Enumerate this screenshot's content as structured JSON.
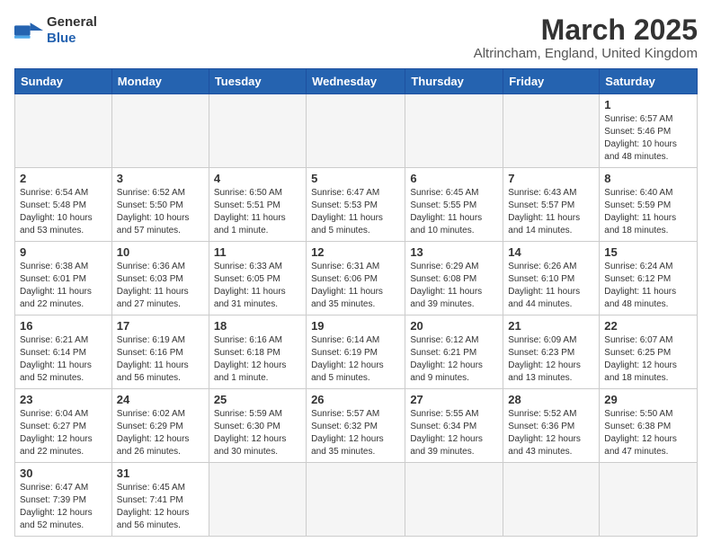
{
  "logo": {
    "line1": "General",
    "line2": "Blue"
  },
  "title": {
    "month_year": "March 2025",
    "location": "Altrincham, England, United Kingdom"
  },
  "headers": [
    "Sunday",
    "Monday",
    "Tuesday",
    "Wednesday",
    "Thursday",
    "Friday",
    "Saturday"
  ],
  "weeks": [
    [
      {
        "day": "",
        "info": ""
      },
      {
        "day": "",
        "info": ""
      },
      {
        "day": "",
        "info": ""
      },
      {
        "day": "",
        "info": ""
      },
      {
        "day": "",
        "info": ""
      },
      {
        "day": "",
        "info": ""
      },
      {
        "day": "1",
        "info": "Sunrise: 6:57 AM\nSunset: 5:46 PM\nDaylight: 10 hours and 48 minutes."
      }
    ],
    [
      {
        "day": "2",
        "info": "Sunrise: 6:54 AM\nSunset: 5:48 PM\nDaylight: 10 hours and 53 minutes."
      },
      {
        "day": "3",
        "info": "Sunrise: 6:52 AM\nSunset: 5:50 PM\nDaylight: 10 hours and 57 minutes."
      },
      {
        "day": "4",
        "info": "Sunrise: 6:50 AM\nSunset: 5:51 PM\nDaylight: 11 hours and 1 minute."
      },
      {
        "day": "5",
        "info": "Sunrise: 6:47 AM\nSunset: 5:53 PM\nDaylight: 11 hours and 5 minutes."
      },
      {
        "day": "6",
        "info": "Sunrise: 6:45 AM\nSunset: 5:55 PM\nDaylight: 11 hours and 10 minutes."
      },
      {
        "day": "7",
        "info": "Sunrise: 6:43 AM\nSunset: 5:57 PM\nDaylight: 11 hours and 14 minutes."
      },
      {
        "day": "8",
        "info": "Sunrise: 6:40 AM\nSunset: 5:59 PM\nDaylight: 11 hours and 18 minutes."
      }
    ],
    [
      {
        "day": "9",
        "info": "Sunrise: 6:38 AM\nSunset: 6:01 PM\nDaylight: 11 hours and 22 minutes."
      },
      {
        "day": "10",
        "info": "Sunrise: 6:36 AM\nSunset: 6:03 PM\nDaylight: 11 hours and 27 minutes."
      },
      {
        "day": "11",
        "info": "Sunrise: 6:33 AM\nSunset: 6:05 PM\nDaylight: 11 hours and 31 minutes."
      },
      {
        "day": "12",
        "info": "Sunrise: 6:31 AM\nSunset: 6:06 PM\nDaylight: 11 hours and 35 minutes."
      },
      {
        "day": "13",
        "info": "Sunrise: 6:29 AM\nSunset: 6:08 PM\nDaylight: 11 hours and 39 minutes."
      },
      {
        "day": "14",
        "info": "Sunrise: 6:26 AM\nSunset: 6:10 PM\nDaylight: 11 hours and 44 minutes."
      },
      {
        "day": "15",
        "info": "Sunrise: 6:24 AM\nSunset: 6:12 PM\nDaylight: 11 hours and 48 minutes."
      }
    ],
    [
      {
        "day": "16",
        "info": "Sunrise: 6:21 AM\nSunset: 6:14 PM\nDaylight: 11 hours and 52 minutes."
      },
      {
        "day": "17",
        "info": "Sunrise: 6:19 AM\nSunset: 6:16 PM\nDaylight: 11 hours and 56 minutes."
      },
      {
        "day": "18",
        "info": "Sunrise: 6:16 AM\nSunset: 6:18 PM\nDaylight: 12 hours and 1 minute."
      },
      {
        "day": "19",
        "info": "Sunrise: 6:14 AM\nSunset: 6:19 PM\nDaylight: 12 hours and 5 minutes."
      },
      {
        "day": "20",
        "info": "Sunrise: 6:12 AM\nSunset: 6:21 PM\nDaylight: 12 hours and 9 minutes."
      },
      {
        "day": "21",
        "info": "Sunrise: 6:09 AM\nSunset: 6:23 PM\nDaylight: 12 hours and 13 minutes."
      },
      {
        "day": "22",
        "info": "Sunrise: 6:07 AM\nSunset: 6:25 PM\nDaylight: 12 hours and 18 minutes."
      }
    ],
    [
      {
        "day": "23",
        "info": "Sunrise: 6:04 AM\nSunset: 6:27 PM\nDaylight: 12 hours and 22 minutes."
      },
      {
        "day": "24",
        "info": "Sunrise: 6:02 AM\nSunset: 6:29 PM\nDaylight: 12 hours and 26 minutes."
      },
      {
        "day": "25",
        "info": "Sunrise: 5:59 AM\nSunset: 6:30 PM\nDaylight: 12 hours and 30 minutes."
      },
      {
        "day": "26",
        "info": "Sunrise: 5:57 AM\nSunset: 6:32 PM\nDaylight: 12 hours and 35 minutes."
      },
      {
        "day": "27",
        "info": "Sunrise: 5:55 AM\nSunset: 6:34 PM\nDaylight: 12 hours and 39 minutes."
      },
      {
        "day": "28",
        "info": "Sunrise: 5:52 AM\nSunset: 6:36 PM\nDaylight: 12 hours and 43 minutes."
      },
      {
        "day": "29",
        "info": "Sunrise: 5:50 AM\nSunset: 6:38 PM\nDaylight: 12 hours and 47 minutes."
      }
    ],
    [
      {
        "day": "30",
        "info": "Sunrise: 6:47 AM\nSunset: 7:39 PM\nDaylight: 12 hours and 52 minutes."
      },
      {
        "day": "31",
        "info": "Sunrise: 6:45 AM\nSunset: 7:41 PM\nDaylight: 12 hours and 56 minutes."
      },
      {
        "day": "",
        "info": ""
      },
      {
        "day": "",
        "info": ""
      },
      {
        "day": "",
        "info": ""
      },
      {
        "day": "",
        "info": ""
      },
      {
        "day": "",
        "info": ""
      }
    ]
  ]
}
